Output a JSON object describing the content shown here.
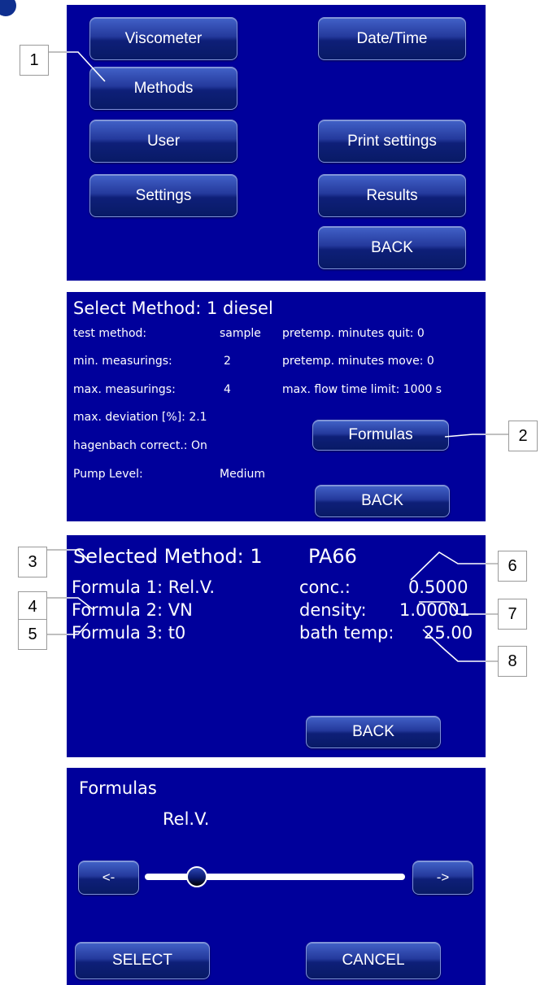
{
  "colors": {
    "panel_bg": "#00009b",
    "button_text": "#ffffff",
    "text": "#ffffff"
  },
  "panel1": {
    "buttons": {
      "viscometer": "Viscometer",
      "date_time": "Date/Time",
      "methods": "Methods",
      "user": "User",
      "print_settings": "Print settings",
      "settings": "Settings",
      "results": "Results",
      "back": "BACK"
    }
  },
  "panel2": {
    "title": "Select Method: 1 diesel",
    "rows": [
      {
        "label": "test method:",
        "value": "sample"
      },
      {
        "label": "min. measurings:",
        "value": "2"
      },
      {
        "label": "max. measurings:",
        "value": "4"
      },
      {
        "label": "max. deviation [%]: 2.1",
        "value": ""
      },
      {
        "label": "hagenbach correct.: On",
        "value": ""
      },
      {
        "label": "Pump Level:",
        "value": "Medium"
      }
    ],
    "right": [
      "pretemp. minutes quit: 0",
      "pretemp. minutes move: 0",
      "max. flow time limit: 1000 s"
    ],
    "formulas_button": "Formulas",
    "back": "BACK"
  },
  "panel3": {
    "title_left": "Selected Method: 1",
    "title_right": "PA66",
    "formulas": [
      "Formula 1: Rel.V.",
      "Formula 2: VN",
      "Formula 3: t0"
    ],
    "params": [
      {
        "label": "conc.:",
        "value": "0.5000"
      },
      {
        "label": "density:",
        "value": "1.00001"
      },
      {
        "label": "bath temp:",
        "value": "25.00"
      }
    ],
    "back": "BACK"
  },
  "panel4": {
    "title": "Formulas",
    "slider_label": "Rel.V.",
    "slider_position": 0.2,
    "prev_button": "<-",
    "next_button": "->",
    "select": "SELECT",
    "cancel": "CANCEL"
  },
  "callouts": [
    "1",
    "2",
    "3",
    "4",
    "5",
    "6",
    "7",
    "8"
  ]
}
